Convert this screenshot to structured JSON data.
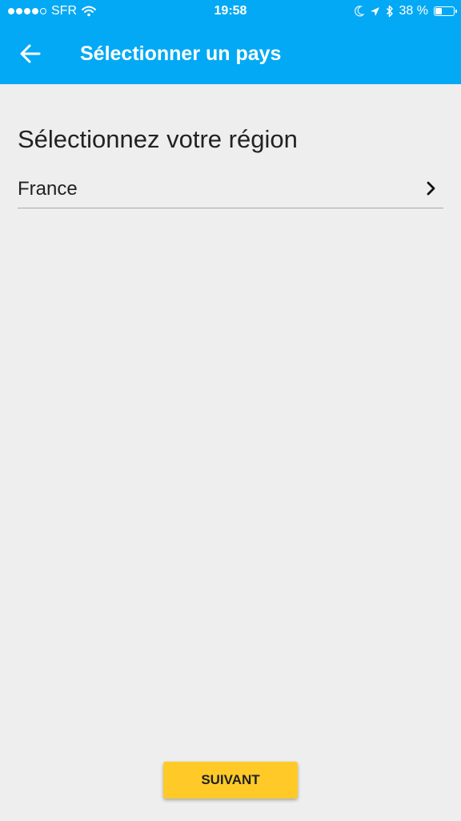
{
  "status_bar": {
    "carrier": "SFR",
    "time": "19:58",
    "battery": "38 %",
    "battery_level": 0.38,
    "signal_bars_filled": 4,
    "signal_bars_total": 5,
    "icons": [
      "wifi-icon",
      "moon-icon",
      "location-arrow-icon",
      "bluetooth-icon",
      "battery-icon"
    ]
  },
  "app_bar": {
    "title": "Sélectionner un pays",
    "back_icon": "arrow-left-icon",
    "color": "#03a9f4"
  },
  "content": {
    "section_title": "Sélectionnez votre région",
    "selected_region": "France",
    "chevron_icon": "chevron-right-icon"
  },
  "footer": {
    "next_label": "SUIVANT",
    "button_color": "#ffca28"
  }
}
